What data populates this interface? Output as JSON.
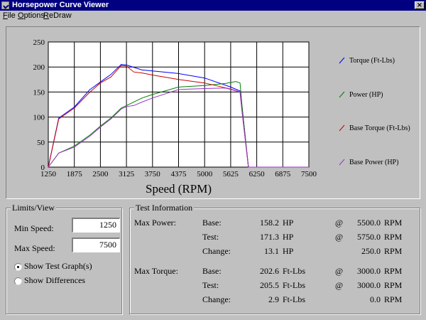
{
  "window": {
    "title": "Horsepower Curve Viewer",
    "close_glyph": "×"
  },
  "menu": [
    {
      "label": "File",
      "underline": "F"
    },
    {
      "label": "Options",
      "underline": "O"
    },
    {
      "label": "ReDraw",
      "underline": "R"
    }
  ],
  "chart_data": {
    "type": "line",
    "title": "",
    "xlabel": "Speed (RPM)",
    "ylabel": "",
    "xlim": [
      1250,
      7500
    ],
    "ylim": [
      0,
      250
    ],
    "grid": true,
    "legend_position": "right",
    "x_ticks": [
      "1250",
      "1875",
      "2500",
      "3125",
      "3750",
      "4375",
      "5000",
      "5625",
      "6250",
      "6875",
      "7500"
    ],
    "y_ticks": [
      "0",
      "50",
      "100",
      "150",
      "200",
      "250"
    ],
    "series": [
      {
        "name": "Torque (Ft-Lbs)",
        "color": "#0000ff",
        "x": [
          1250,
          1500,
          1875,
          2250,
          2500,
          2750,
          3000,
          3125,
          3500,
          3750,
          4375,
          5000,
          5625,
          5850,
          5900,
          6050,
          6250,
          6875,
          7500
        ],
        "y": [
          0,
          98,
          120,
          155,
          170,
          185,
          205,
          204,
          194,
          192,
          187,
          178,
          160,
          152,
          120,
          0,
          0,
          0,
          0
        ]
      },
      {
        "name": "Power (HP)",
        "color": "#008000",
        "x": [
          1250,
          1500,
          1875,
          2250,
          2500,
          2750,
          3000,
          3125,
          3500,
          3750,
          4375,
          5000,
          5500,
          5750,
          5850,
          5900,
          6050,
          6250,
          6875,
          7500
        ],
        "y": [
          0,
          28,
          42,
          64,
          82,
          98,
          118,
          123,
          138,
          145,
          160,
          163,
          167,
          171,
          168,
          120,
          0,
          0,
          0,
          0
        ]
      },
      {
        "name": "Base Torque (Ft-Lbs)",
        "color": "#cc0000",
        "x": [
          1250,
          1500,
          1875,
          2250,
          2500,
          2750,
          3000,
          3125,
          3300,
          3500,
          3750,
          4375,
          5000,
          5625,
          5850,
          5900,
          6050,
          6250,
          6875,
          7500
        ],
        "y": [
          0,
          96,
          118,
          150,
          168,
          180,
          203,
          202,
          190,
          188,
          184,
          175,
          168,
          156,
          150,
          110,
          0,
          0,
          0,
          0
        ]
      },
      {
        "name": "Base Power (HP)",
        "color": "#9933cc",
        "x": [
          1250,
          1500,
          1875,
          2250,
          2500,
          2750,
          3000,
          3125,
          3300,
          3500,
          3750,
          4375,
          5000,
          5500,
          5850,
          5900,
          6050,
          6250,
          6875,
          7500
        ],
        "y": [
          0,
          28,
          40,
          62,
          80,
          96,
          116,
          121,
          123,
          130,
          138,
          155,
          157,
          158,
          150,
          110,
          0,
          0,
          0,
          0
        ]
      }
    ]
  },
  "limits": {
    "group_label": "Limits/View",
    "min_speed_label": "Min Speed:",
    "min_speed_value": "1250",
    "max_speed_label": "Max Speed:",
    "max_speed_value": "7500",
    "radio_test_label": "Show Test Graph(s)",
    "radio_diff_label": "Show Differences",
    "selected": "test"
  },
  "test_info": {
    "group_label": "Test Information",
    "at": "@",
    "max_power": {
      "label": "Max Power:",
      "rows": [
        {
          "label": "Base:",
          "value": "158.2",
          "unit": "HP",
          "at": true,
          "rpm": "5500.0",
          "rpm_unit": "RPM"
        },
        {
          "label": "Test:",
          "value": "171.3",
          "unit": "HP",
          "at": true,
          "rpm": "5750.0",
          "rpm_unit": "RPM"
        },
        {
          "label": "Change:",
          "value": "13.1",
          "unit": "HP",
          "at": false,
          "rpm": "250.0",
          "rpm_unit": "RPM"
        }
      ]
    },
    "max_torque": {
      "label": "Max Torque:",
      "rows": [
        {
          "label": "Base:",
          "value": "202.6",
          "unit": "Ft-Lbs",
          "at": true,
          "rpm": "3000.0",
          "rpm_unit": "RPM"
        },
        {
          "label": "Test:",
          "value": "205.5",
          "unit": "Ft-Lbs",
          "at": true,
          "rpm": "3000.0",
          "rpm_unit": "RPM"
        },
        {
          "label": "Change:",
          "value": "2.9",
          "unit": "Ft-Lbs",
          "at": false,
          "rpm": "0.0",
          "rpm_unit": "RPM"
        }
      ]
    }
  }
}
